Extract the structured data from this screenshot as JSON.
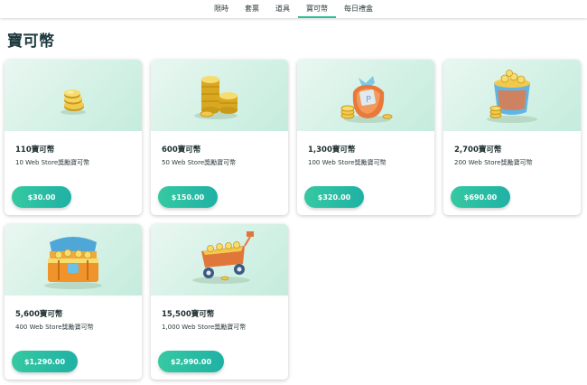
{
  "nav": {
    "tabs": [
      {
        "label": "限時",
        "active": false
      },
      {
        "label": "套票",
        "active": false
      },
      {
        "label": "道具",
        "active": false
      },
      {
        "label": "寶可幣",
        "active": true
      },
      {
        "label": "每日禮盒",
        "active": false
      }
    ]
  },
  "page": {
    "title": "寶可幣"
  },
  "items": [
    {
      "title": "110寶可幣",
      "subtitle": "10 Web Store獎勵寶可幣",
      "price": "$30.00",
      "image": "small-coin-stack-icon"
    },
    {
      "title": "600寶可幣",
      "subtitle": "50 Web Store獎勵寶可幣",
      "price": "$150.00",
      "image": "coin-stacks-icon"
    },
    {
      "title": "1,300寶可幣",
      "subtitle": "100 Web Store獎勵寶可幣",
      "price": "$320.00",
      "image": "coin-bag-icon"
    },
    {
      "title": "2,700寶可幣",
      "subtitle": "200 Web Store獎勵寶可幣",
      "price": "$690.00",
      "image": "coin-bucket-icon"
    },
    {
      "title": "5,600寶可幣",
      "subtitle": "400 Web Store獎勵寶可幣",
      "price": "$1,290.00",
      "image": "treasure-chest-icon"
    },
    {
      "title": "15,500寶可幣",
      "subtitle": "1,000 Web Store獎勵寶可幣",
      "price": "$2,990.00",
      "image": "coin-cart-icon"
    }
  ],
  "colors": {
    "accent": "#2bbf9a",
    "button_start": "#36c9a2",
    "button_end": "#1fb1a4",
    "card_bg": "#d4f1e6",
    "title": "#1e3a3f"
  }
}
